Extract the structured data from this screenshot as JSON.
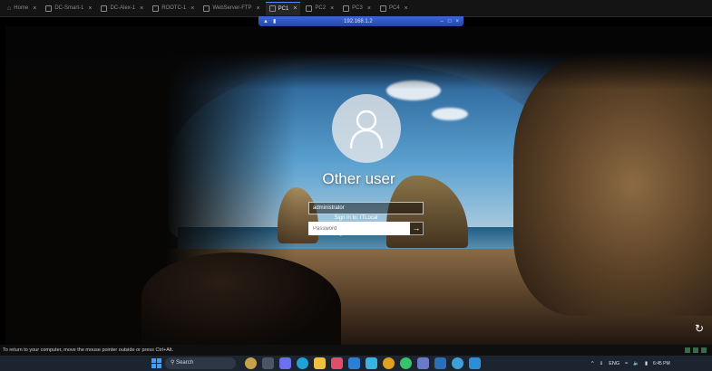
{
  "tabs": [
    {
      "label": "Home",
      "icon": "home-icon",
      "active": false
    },
    {
      "label": "DC-Smart-1",
      "icon": "vm-icon",
      "active": false
    },
    {
      "label": "DC-Alex-1",
      "icon": "vm-icon",
      "active": false
    },
    {
      "label": "ROOTC-1",
      "icon": "vm-icon",
      "active": false
    },
    {
      "label": "WebServer-FTP",
      "icon": "vm-icon",
      "active": false
    },
    {
      "label": "PC1",
      "icon": "vm-icon",
      "active": true
    },
    {
      "label": "PC2",
      "icon": "vm-icon",
      "active": false
    },
    {
      "label": "PC3",
      "icon": "vm-icon",
      "active": false
    },
    {
      "label": "PC4",
      "icon": "vm-icon",
      "active": false
    }
  ],
  "vm_bar": {
    "title": "192.168.1.2"
  },
  "login": {
    "username_heading": "Other user",
    "user_field_value": "administrator",
    "password_placeholder": "Password",
    "sign_in_to": "Sign in to: ITLocal",
    "domain_link": "How do I sign in to another domain?"
  },
  "status_text": "To return to your computer, move the mouse pointer outside or press Ctrl+Alt.",
  "taskbar": {
    "search_label": "Search",
    "tray_lang": "ENG",
    "time": "6:45 PM",
    "date": ""
  },
  "colors": {
    "accent": "#3aa0ff",
    "vm_bar": "#2b55c4"
  }
}
